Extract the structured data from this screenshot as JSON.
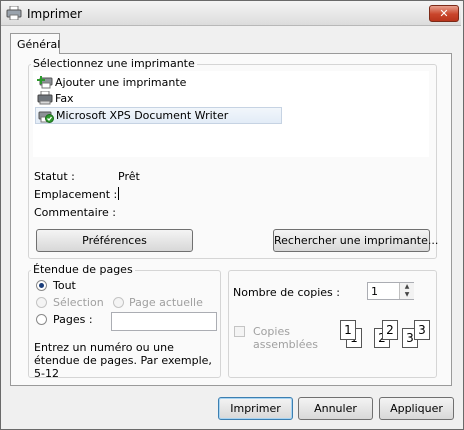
{
  "window": {
    "title": "Imprimer",
    "close_label": "✕"
  },
  "tabs": [
    {
      "label": "Général",
      "active": true
    }
  ],
  "printer_group": {
    "legend": "Sélectionnez une imprimante",
    "printers": [
      {
        "label": "Ajouter une imprimante",
        "icon": "add-printer-icon",
        "selected": false
      },
      {
        "label": "Fax",
        "icon": "fax-printer-icon",
        "selected": false
      },
      {
        "label": "Microsoft XPS Document Writer",
        "icon": "default-printer-icon",
        "selected": true
      }
    ],
    "status_label": "Statut :",
    "status_value": "Prêt",
    "location_label": "Emplacement :",
    "location_value": "",
    "comment_label": "Commentaire :",
    "comment_value": "",
    "preferences_button": "Préférences",
    "find_printer_button": "Rechercher une imprimante..."
  },
  "page_range": {
    "legend": "Étendue de pages",
    "all_label": "Tout",
    "all_checked": true,
    "selection_label": "Sélection",
    "selection_enabled": false,
    "current_page_label": "Page actuelle",
    "current_page_enabled": false,
    "pages_label": "Pages :",
    "pages_value": "",
    "hint": "Entrez un numéro ou une étendue de pages. Par exemple, 5-12"
  },
  "copies": {
    "count_label": "Nombre de copies :",
    "count_value": "1",
    "collate_label_line1": "Copies",
    "collate_label_line2": "assemblées",
    "collate_enabled": false,
    "collate_checked": false,
    "illustration_pages": [
      "1",
      "1",
      "2",
      "2",
      "3",
      "3"
    ]
  },
  "footer": {
    "print_button": "Imprimer",
    "cancel_button": "Annuler",
    "apply_button": "Appliquer"
  },
  "colors": {
    "close_button": "#c9452a",
    "selection_highlight": "#e3ecf7",
    "default_button_border": "#3c7fb1"
  }
}
